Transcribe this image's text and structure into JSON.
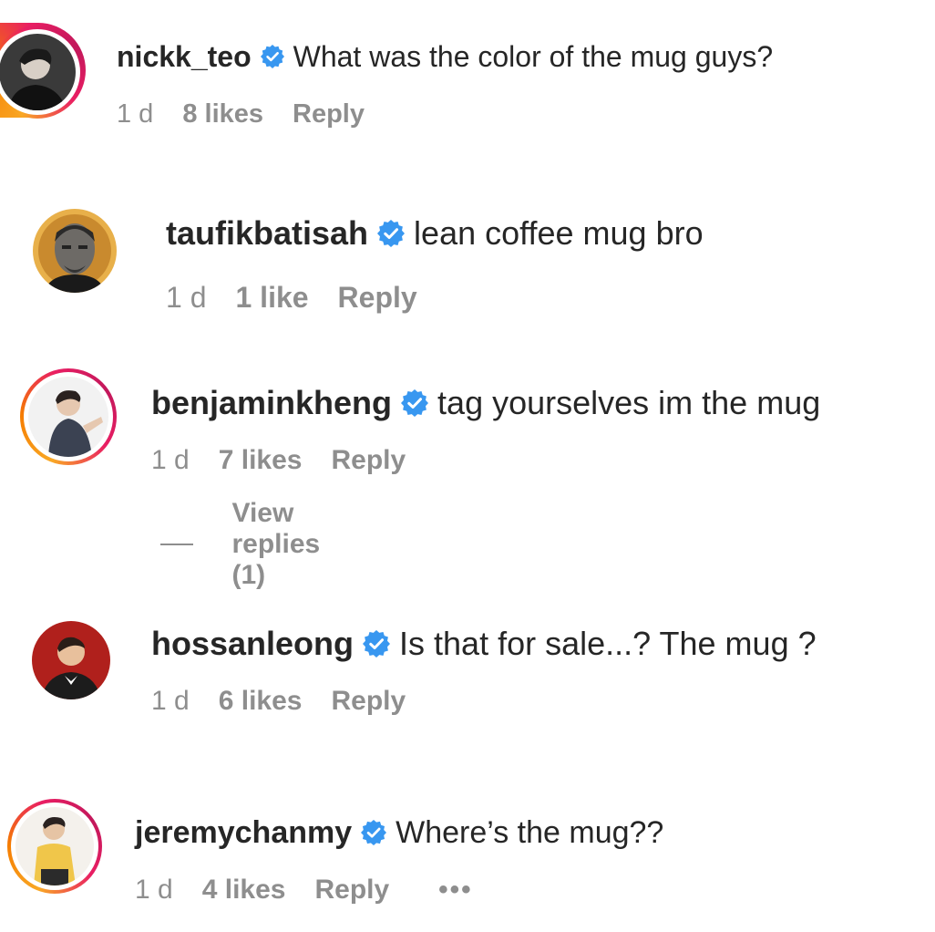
{
  "comments": [
    {
      "username": "nickk_teo",
      "text": "What was the color of the mug guys?",
      "time": "1 d",
      "likes": "8 likes",
      "reply": "Reply"
    },
    {
      "username": "taufikbatisah",
      "text": "lean coffee mug bro",
      "time": "1 d",
      "likes": "1 like",
      "reply": "Reply"
    },
    {
      "username": "benjaminkheng",
      "text": "tag yourselves im the mug",
      "time": "1 d",
      "likes": "7 likes",
      "reply": "Reply"
    },
    {
      "username": "hossanleong",
      "text": "Is that for sale...? The mug ?",
      "time": "1 d",
      "likes": "6 likes",
      "reply": "Reply"
    },
    {
      "username": "jeremychanmy",
      "text": "Where’s the mug??",
      "time": "1 d",
      "likes": "4 likes",
      "reply": "Reply",
      "more": "•••"
    }
  ],
  "view_replies": "View replies (1)",
  "colors": {
    "verified": "#3897f0",
    "muted": "#8e8e8e",
    "text": "#262626"
  }
}
